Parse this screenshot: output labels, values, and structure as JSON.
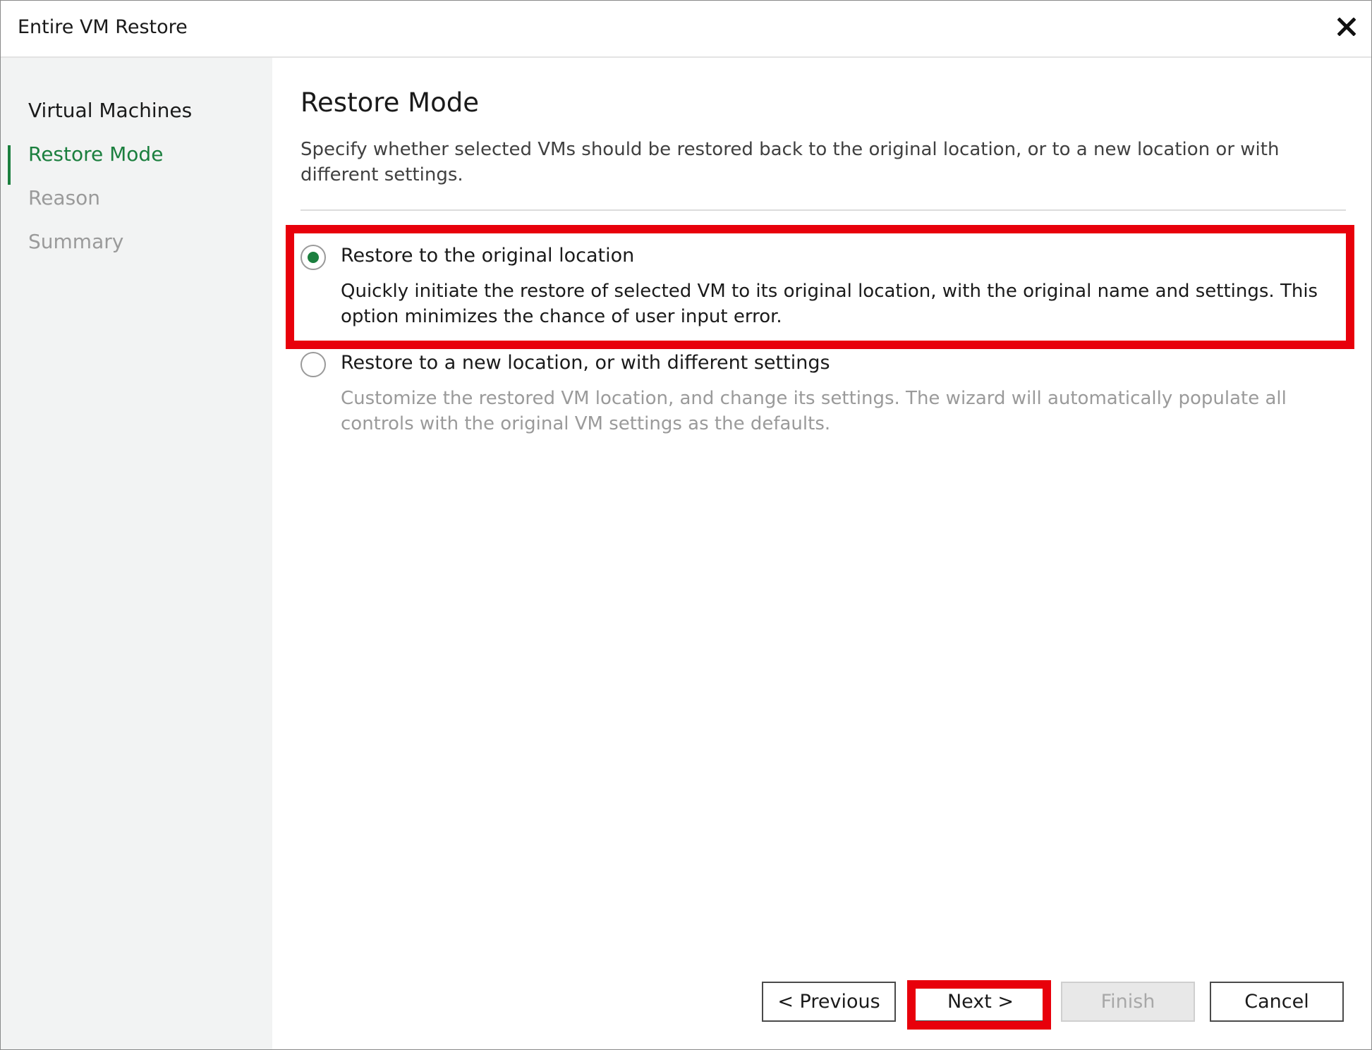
{
  "window": {
    "title": "Entire VM Restore",
    "close_icon": "close-icon"
  },
  "sidebar": {
    "items": [
      {
        "label": "Virtual Machines",
        "state": "done"
      },
      {
        "label": "Restore Mode",
        "state": "active"
      },
      {
        "label": "Reason",
        "state": "pending"
      },
      {
        "label": "Summary",
        "state": "pending"
      }
    ]
  },
  "main": {
    "heading": "Restore Mode",
    "description": "Specify whether selected VMs should be restored back to the original location, or to a new location or with different settings.",
    "options": [
      {
        "label": "Restore to the original location",
        "description": "Quickly initiate the restore of selected VM to its original location, with the original name and settings. This option minimizes the chance of user input error.",
        "selected": true
      },
      {
        "label": "Restore to a new location, or with different settings",
        "description": "Customize the restored VM location, and change its settings. The wizard will automatically populate all controls with the original VM settings as the defaults.",
        "selected": false
      }
    ]
  },
  "footer": {
    "previous_label": "< Previous",
    "next_label": "Next >",
    "finish_label": "Finish",
    "cancel_label": "Cancel"
  },
  "colors": {
    "accent": "#1b7f3e",
    "highlight": "#e8000b",
    "sidebar_bg": "#f2f3f3"
  }
}
